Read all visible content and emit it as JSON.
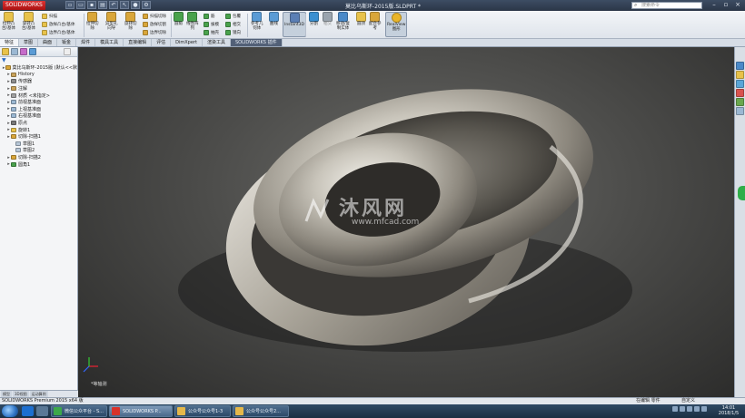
{
  "titlebar": {
    "logo": "SOLIDWORKS",
    "title": "莫比乌斯环-2015版.SLDPRT *",
    "search_placeholder": "搜索命令",
    "minimize": "–",
    "maximize": "▫",
    "close": "×"
  },
  "ribbon": {
    "large": [
      {
        "label": "拉伸凸\n台/基体",
        "color": "#e8c24a"
      },
      {
        "label": "旋转凸\n台/基体",
        "color": "#e8c24a"
      },
      {
        "label": "拉伸切\n除",
        "color": "#d9a63a"
      },
      {
        "label": "异型孔\n向导",
        "color": "#d9a63a"
      },
      {
        "label": "旋转切\n除",
        "color": "#d9a63a"
      },
      {
        "label": "圆角",
        "color": "#49a24c"
      },
      {
        "label": "线性阵\n列",
        "color": "#49a24c"
      },
      {
        "label": "参考几\n何体",
        "color": "#5a9bd5"
      },
      {
        "label": "曲线",
        "color": "#5a9bd5"
      },
      {
        "label": "Instant3D",
        "color": "#5b7fb5"
      },
      {
        "label": "分割",
        "color": "#3a8fd0"
      },
      {
        "label": "相交",
        "color": "#9aa4ae"
      },
      {
        "label": "移动/复\n制实体",
        "color": "#4a89c8"
      },
      {
        "label": "圆顶",
        "color": "#e8c24a"
      },
      {
        "label": "配合参\n考",
        "color": "#d9a63a"
      },
      {
        "label": "RealView\n图形",
        "color": "#e9b52a"
      }
    ],
    "small": [
      {
        "label": "扫描",
        "color": "#e8c24a"
      },
      {
        "label": "放样凸台/基体",
        "color": "#e8c24a"
      },
      {
        "label": "边界凸台/基体",
        "color": "#e8c24a"
      },
      {
        "label": "扫描切除",
        "color": "#d9a63a"
      },
      {
        "label": "放样切割",
        "color": "#d9a63a"
      },
      {
        "label": "边界切除",
        "color": "#d9a63a"
      },
      {
        "label": "筋",
        "color": "#49a24c"
      },
      {
        "label": "拔模",
        "color": "#49a24c"
      },
      {
        "label": "抽壳",
        "color": "#49a24c"
      },
      {
        "label": "包覆",
        "color": "#49a24c"
      },
      {
        "label": "相交",
        "color": "#49a24c"
      },
      {
        "label": "镜向",
        "color": "#49a24c"
      }
    ]
  },
  "tabs": [
    "特征",
    "草图",
    "曲面",
    "钣金",
    "焊件",
    "模具工具",
    "直接编辑",
    "评估",
    "DimXpert",
    "渲染工具",
    "SOLIDWORKS 插件"
  ],
  "feature_manager": {
    "filter_icon": "filter-icon",
    "tree": [
      {
        "label": "莫比乌斯环-2015版 (默认<<默",
        "indent": 0,
        "color": "#d9a63a"
      },
      {
        "label": "History",
        "indent": 1,
        "color": "#c9a25a"
      },
      {
        "label": "传感器",
        "indent": 1,
        "color": "#8c8c8c"
      },
      {
        "label": "注解",
        "indent": 1,
        "color": "#c9a25a"
      },
      {
        "label": "材质 <未指定>",
        "indent": 1,
        "color": "#a0a0a0"
      },
      {
        "label": "前视基准面",
        "indent": 1,
        "color": "#9bb8d3"
      },
      {
        "label": "上视基准面",
        "indent": 1,
        "color": "#9bb8d3"
      },
      {
        "label": "右视基准面",
        "indent": 1,
        "color": "#9bb8d3"
      },
      {
        "label": "原点",
        "indent": 1,
        "color": "#777"
      },
      {
        "label": "旋转1",
        "indent": 1,
        "color": "#e8c24a"
      },
      {
        "label": "切除-扫描1",
        "indent": 1,
        "color": "#d9a63a"
      },
      {
        "label": "草图1",
        "indent": 2,
        "color": "#b7c7d8"
      },
      {
        "label": "草图2",
        "indent": 2,
        "color": "#b7c7d8"
      },
      {
        "label": "切除-扫描2",
        "indent": 1,
        "color": "#d9a63a"
      },
      {
        "label": "圆角1",
        "indent": 1,
        "color": "#49a24c"
      }
    ],
    "bottom_tabs": [
      "模型",
      "3D视图",
      "运动算例"
    ]
  },
  "viewport": {
    "watermark_cn": "沐风网",
    "watermark_en": "www.mfcad.com",
    "view_label": "*等轴测"
  },
  "statusbar": {
    "left": "SOLIDWORKS Premium 2015 x64 版",
    "editing": "在编辑 零件",
    "units": "自定义"
  },
  "taskbar": {
    "apps": [
      {
        "label": "微信公众平台 - S...",
        "color": "#3da84a"
      },
      {
        "label": "SOLIDWORKS P...",
        "color": "#d8322a"
      },
      {
        "label": "公众号公众号1-3",
        "color": "#e5b84a"
      },
      {
        "label": "公众号公众号2...",
        "color": "#e5b84a"
      }
    ],
    "time": "14:01",
    "date": "2018/1/5"
  }
}
